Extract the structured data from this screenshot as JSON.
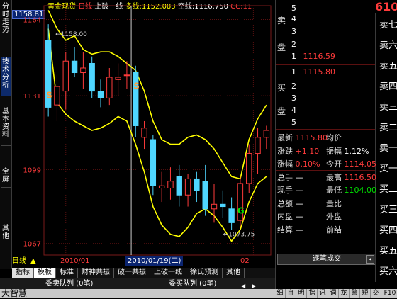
{
  "left_tabs": [
    "分时走势",
    "技术分析",
    "基本资料",
    "全屏",
    "其他"
  ],
  "chart": {
    "title": "黄金现货",
    "period": "日线",
    "indicator": "上破一线",
    "avg_label": "多线:",
    "avg_value": "1152.083",
    "blank_label": "空线:",
    "blank_value": "1116.750",
    "cc_label": "CC:",
    "cc_value": "11",
    "price_readout": "1158.81",
    "y_ticks": [
      "1164",
      "1131",
      "1099",
      "1067"
    ],
    "high_annotation": "1158.00",
    "low_annotation": "1073.75",
    "signal_s": "S",
    "signal_g": "G",
    "x_label_left": "2010/01",
    "x_label_cursor": "2010/01/19(二)",
    "x_label_right": "02",
    "bottom_indicator": "日线"
  },
  "chart_data": {
    "type": "candlestick",
    "ylim": [
      1062,
      1170
    ],
    "y_ticks": [
      1164,
      1131,
      1099,
      1067
    ],
    "candles": [
      {
        "o": 1155,
        "h": 1162,
        "l": 1122,
        "c": 1126,
        "up": false
      },
      {
        "o": 1127,
        "h": 1140,
        "l": 1120,
        "c": 1135,
        "up": true
      },
      {
        "o": 1133,
        "h": 1150,
        "l": 1125,
        "c": 1146,
        "up": true
      },
      {
        "o": 1146,
        "h": 1152,
        "l": 1139,
        "c": 1141,
        "up": false
      },
      {
        "o": 1141,
        "h": 1150,
        "l": 1134,
        "c": 1143,
        "up": true
      },
      {
        "o": 1145,
        "h": 1148,
        "l": 1130,
        "c": 1133,
        "up": false
      },
      {
        "o": 1133,
        "h": 1138,
        "l": 1126,
        "c": 1130,
        "up": false
      },
      {
        "o": 1130,
        "h": 1143,
        "l": 1127,
        "c": 1139,
        "up": true
      },
      {
        "o": 1139,
        "h": 1145,
        "l": 1131,
        "c": 1138,
        "up": true
      },
      {
        "o": 1140,
        "h": 1146,
        "l": 1134,
        "c": 1140,
        "up": true
      },
      {
        "o": 1141,
        "h": 1144,
        "l": 1113,
        "c": 1118,
        "up": false
      },
      {
        "o": 1117,
        "h": 1120,
        "l": 1108,
        "c": 1113,
        "up": true
      },
      {
        "o": 1112,
        "h": 1114,
        "l": 1088,
        "c": 1092,
        "up": false
      },
      {
        "o": 1092,
        "h": 1098,
        "l": 1085,
        "c": 1091,
        "up": true
      },
      {
        "o": 1091,
        "h": 1100,
        "l": 1086,
        "c": 1094,
        "up": true
      },
      {
        "o": 1096,
        "h": 1101,
        "l": 1083,
        "c": 1088,
        "up": false
      },
      {
        "o": 1088,
        "h": 1097,
        "l": 1083,
        "c": 1095,
        "up": true
      },
      {
        "o": 1095,
        "h": 1098,
        "l": 1085,
        "c": 1090,
        "up": false
      },
      {
        "o": 1094,
        "h": 1101,
        "l": 1079,
        "c": 1082,
        "up": false
      },
      {
        "o": 1082,
        "h": 1093,
        "l": 1076,
        "c": 1084,
        "up": true
      },
      {
        "o": 1084,
        "h": 1090,
        "l": 1078,
        "c": 1083,
        "up": false
      },
      {
        "o": 1082,
        "h": 1087,
        "l": 1073,
        "c": 1076,
        "up": false
      },
      {
        "o": 1077,
        "h": 1096,
        "l": 1074,
        "c": 1093,
        "up": true
      },
      {
        "o": 1093,
        "h": 1110,
        "l": 1089,
        "c": 1106,
        "up": true
      },
      {
        "o": 1106,
        "h": 1117,
        "l": 1097,
        "c": 1113,
        "up": true
      },
      {
        "o": 1113,
        "h": 1118,
        "l": 1108,
        "c": 1116,
        "up": true
      }
    ],
    "upper_line": [
      1168,
      1160,
      1155,
      1157,
      1151,
      1149,
      1150,
      1150,
      1148,
      1145,
      1142,
      1133,
      1120,
      1112,
      1110,
      1110,
      1113,
      1114,
      1112,
      1108,
      1102,
      1096,
      1095,
      1112,
      1121,
      1127
    ],
    "lower_line": [
      1160,
      1128,
      1123,
      1120,
      1118,
      1116,
      1117,
      1119,
      1122,
      1120,
      1110,
      1098,
      1083,
      1075,
      1071,
      1070,
      1074,
      1080,
      1082,
      1079,
      1074,
      1068,
      1073,
      1085,
      1093,
      1096
    ]
  },
  "quote_panel": {
    "top_price": "610",
    "sell_label": [
      "卖",
      "盘"
    ],
    "buy_label": [
      "买",
      "盘"
    ],
    "sell_rows": [
      {
        "level": "5",
        "price": ""
      },
      {
        "level": "4",
        "price": ""
      },
      {
        "level": "3",
        "price": ""
      },
      {
        "level": "2",
        "price": ""
      },
      {
        "level": "1",
        "price": "1116.59"
      }
    ],
    "buy_rows": [
      {
        "level": "1",
        "price": "1115.80"
      },
      {
        "level": "2",
        "price": ""
      },
      {
        "level": "3",
        "price": ""
      },
      {
        "level": "4",
        "price": ""
      },
      {
        "level": "5",
        "price": ""
      }
    ],
    "stats": [
      {
        "k1": "最新",
        "v1": "1115.80",
        "k2": "均价",
        "v2": ""
      },
      {
        "k1": "涨跌",
        "v1": "+1.10",
        "k2": "振幅",
        "v2": "1.12%"
      },
      {
        "k1": "涨幅",
        "v1": "0.10%",
        "k2": "今开",
        "v2": "1114.05"
      },
      {
        "k1": "总手",
        "v1": "—",
        "k2": "最高",
        "v2": "1116.50"
      },
      {
        "k1": "现手",
        "v1": "—",
        "k2": "最低",
        "v2": "1104.00"
      },
      {
        "k1": "总额",
        "v1": "—",
        "k2": "量比",
        "v2": ""
      },
      {
        "k1": "内盘",
        "v1": "—",
        "k2": "外盘",
        "v2": ""
      },
      {
        "k1": "结算",
        "v1": "—",
        "k2": "前结",
        "v2": ""
      }
    ],
    "trade_detail_button": "逐笔成交",
    "side_column": [
      "卖七",
      "卖六",
      "卖五",
      "卖四",
      "卖三",
      "卖二",
      "卖一",
      "买一",
      "买二",
      "买三",
      "买四",
      "买五",
      "买六"
    ]
  },
  "bottom_tabs": [
    "指标",
    "模板",
    "标准",
    "财神共振",
    "破一共振",
    "上破一线",
    "徐氏预测",
    "其他"
  ],
  "queue_bar": {
    "buy_queue": "委卖队列 (0笔)",
    "sell_queue": "委买队列 (0笔)"
  },
  "status_bar": {
    "brand": "大智慧",
    "buttons": [
      "细",
      "自",
      "明",
      "指",
      "讯",
      "词",
      "龙",
      "警",
      "短",
      "交",
      "F10"
    ]
  }
}
